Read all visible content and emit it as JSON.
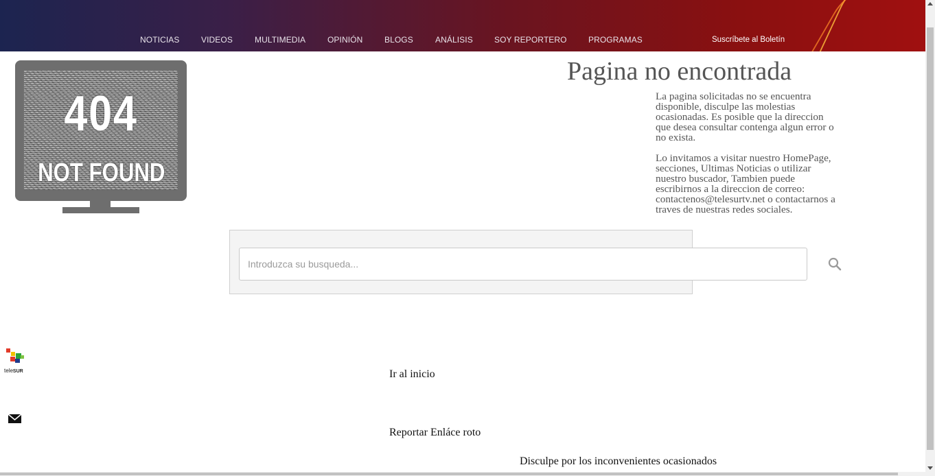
{
  "nav": {
    "items": [
      {
        "label": "NOTICIAS"
      },
      {
        "label": "VIDEOS"
      },
      {
        "label": "MULTIMEDIA"
      },
      {
        "label": "OPINIÓN"
      },
      {
        "label": "BLOGS"
      },
      {
        "label": "ANÁLISIS"
      },
      {
        "label": "SOY REPORTERO"
      },
      {
        "label": "PROGRAMAS"
      }
    ],
    "subscribe_label": "Suscríbete al Boletín"
  },
  "error_image": {
    "code": "404",
    "message": "NOT FOUND"
  },
  "main": {
    "title": "Pagina no encontrada",
    "paragraph1": "La pagina solicitadas no se encuentra disponible, disculpe las molestias ocasionadas. Es posible que la direccion que desea consultar contenga algun error o no exista.",
    "paragraph2": "Lo invitamos a visitar nuestro HomePage, secciones, Ultimas Noticias o utilizar nuestro buscador, Tambien puede escribirnos a la direccion de correo: contactenos@telesurtv.net o contactarnos a traves de nuestras redes sociales."
  },
  "search": {
    "placeholder": "Introduzca su busqueda...",
    "value": "",
    "icon": "search-icon"
  },
  "sidebar": {
    "logo_text_tele": "tele",
    "logo_text_sur": "SUR",
    "mail_icon": "mail-icon"
  },
  "links": {
    "home": "Ir al inicio",
    "report": "Reportar Enláce roto"
  },
  "footer": {
    "apology": "Disculpe por los inconvenientes ocasionados"
  },
  "colors": {
    "header_start": "#1c2450",
    "header_end": "#a01010",
    "title_text": "#555555"
  }
}
